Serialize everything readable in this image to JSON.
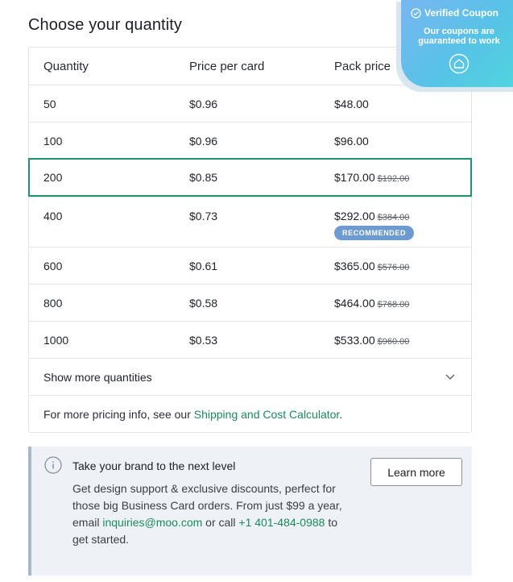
{
  "section_title": "Choose your quantity",
  "table": {
    "headers": [
      "Quantity",
      "Price per card",
      "Pack price"
    ],
    "rows": [
      {
        "qty": "50",
        "unit": "$0.96",
        "pack": "$48.00",
        "was": ""
      },
      {
        "qty": "100",
        "unit": "$0.96",
        "pack": "$96.00",
        "was": ""
      },
      {
        "qty": "200",
        "unit": "$0.85",
        "pack": "$170.00",
        "was": "$192.00",
        "selected": true
      },
      {
        "qty": "400",
        "unit": "$0.73",
        "pack": "$292.00",
        "was": "$384.00",
        "badge": "RECOMMENDED"
      },
      {
        "qty": "600",
        "unit": "$0.61",
        "pack": "$365.00",
        "was": "$576.00"
      },
      {
        "qty": "800",
        "unit": "$0.58",
        "pack": "$464.00",
        "was": "$768.00"
      },
      {
        "qty": "1000",
        "unit": "$0.53",
        "pack": "$533.00",
        "was": "$960.00"
      }
    ],
    "show_more": "Show more quantities",
    "pricing_info_prefix": "For more pricing info, see our ",
    "pricing_info_link": "Shipping and Cost Calculator",
    "pricing_info_suffix": "."
  },
  "promo": {
    "heading": "Take your brand to the next level",
    "body_1": "Get design support & exclusive discounts, perfect for those big Business Card orders. From just $99 a year, email ",
    "email": "inquiries@moo.com",
    "body_2": " or call ",
    "phone": "+1 401-484-0988",
    "body_3": " to get started.",
    "button": "Learn more"
  },
  "coupon": {
    "title": "Verified Coupon",
    "subtitle": "Our coupons are guaranteed to work"
  },
  "colors": {
    "accent_green": "#1a8a5b",
    "selected_border": "#21946b",
    "badge": "#6d9bd1"
  },
  "icons": {
    "info": "info-circle-icon",
    "chevron": "chevron-down-icon",
    "check": "check-circle-icon",
    "home": "home-icon"
  }
}
